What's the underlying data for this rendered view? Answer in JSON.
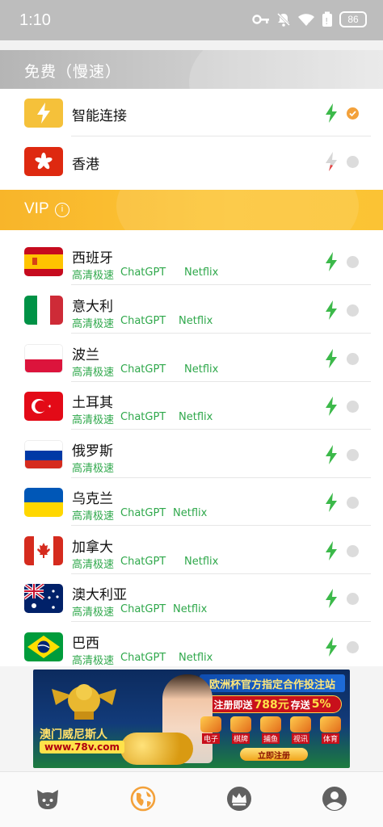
{
  "status_bar": {
    "time": "1:10",
    "battery": "86",
    "icons": [
      "key-icon",
      "bell-off-icon",
      "wifi-icon",
      "battery-saver-icon",
      "battery-icon"
    ]
  },
  "free_section": {
    "title": "免费（慢速）"
  },
  "free_servers": [
    {
      "name": "智能连接",
      "flag": "lightning-icon",
      "selected": true,
      "signal": "green"
    },
    {
      "name": "香港",
      "flag": "hong-kong-flag",
      "selected": false,
      "signal": "gray-red"
    }
  ],
  "vip_section": {
    "title": "VIP",
    "info_icon": "info-icon"
  },
  "vip_servers": [
    {
      "name": "西班牙",
      "flag": "spain-flag",
      "tags": [
        "高清极速",
        "ChatGPT",
        "Netflix"
      ]
    },
    {
      "name": "意大利",
      "flag": "italy-flag",
      "tags": [
        "高清极速",
        "ChatGPT",
        "Netflix"
      ]
    },
    {
      "name": "波兰",
      "flag": "poland-flag",
      "tags": [
        "高清极速",
        "ChatGPT",
        "Netflix"
      ]
    },
    {
      "name": "土耳其",
      "flag": "turkey-flag",
      "tags": [
        "高清极速",
        "ChatGPT",
        "Netflix"
      ]
    },
    {
      "name": "俄罗斯",
      "flag": "russia-flag",
      "tags": [
        "高清极速"
      ]
    },
    {
      "name": "乌克兰",
      "flag": "ukraine-flag",
      "tags": [
        "高清极速",
        "ChatGPT",
        "Netflix"
      ]
    },
    {
      "name": "加拿大",
      "flag": "canada-flag",
      "tags": [
        "高清极速",
        "ChatGPT",
        "Netflix"
      ]
    },
    {
      "name": "澳大利亚",
      "flag": "australia-flag",
      "tags": [
        "高清极速",
        "ChatGPT",
        "Netflix"
      ]
    },
    {
      "name": "巴西",
      "flag": "brazil-flag",
      "tags": [
        "高清极速",
        "ChatGPT",
        "Netflix"
      ]
    }
  ],
  "ad_banner": {
    "headline": "欧洲杯官方指定合作投注站",
    "promo_prefix": "注册即送",
    "promo_amount": "788元",
    "promo_mid": "存送",
    "promo_percent": "5%",
    "brand": "澳门威尼斯人",
    "url": "www.78v.com",
    "games": [
      "电子",
      "棋牌",
      "捕鱼",
      "视讯",
      "体育"
    ],
    "cta": "立即注册"
  },
  "tab_bar": {
    "tabs": [
      {
        "icon": "cat-icon",
        "active": false
      },
      {
        "icon": "globe-icon",
        "active": true
      },
      {
        "icon": "crown-icon",
        "active": false
      },
      {
        "icon": "profile-icon",
        "active": false
      }
    ]
  },
  "colors": {
    "accent": "#f3a13a",
    "vip_banner": "#fcc637",
    "tag_green": "#2fa84b",
    "signal_green": "#3cb94a"
  }
}
